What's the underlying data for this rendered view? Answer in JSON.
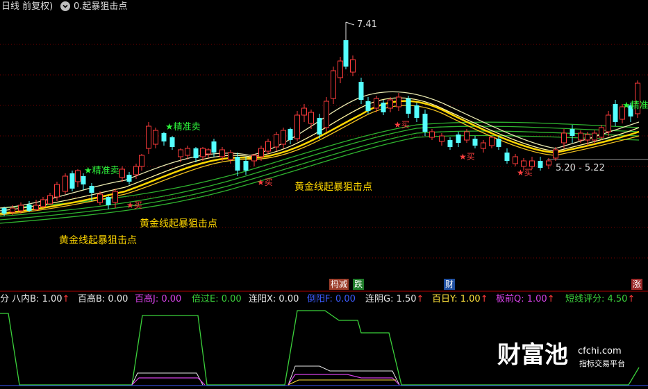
{
  "header": {
    "period": "日线 前复权)",
    "dropdown_icon": "chevron-down-circle-icon",
    "indicator_title": "0.起暴狙击点"
  },
  "colors": {
    "up": "#ff3b3b",
    "down": "#54ffff",
    "gold": "#ffd700",
    "green_ma": "#2fb32f",
    "ma_light": "#fff6a0",
    "buy": "#ff4040",
    "sell": "#2df03a"
  },
  "labels": {
    "price_high": "7.41",
    "price_range": "5.20 - 5.22",
    "sell_signal_1": "★精准卖",
    "sell_signal_2": "★精准卖",
    "sell_signal_3": "★精准",
    "buy_signal": "★买",
    "golden_line_text": "黄金线起暴狙击点"
  },
  "tags": {
    "drop_reduce": "杩减",
    "fall": "跌",
    "finance": "财",
    "rise": "涨"
  },
  "indicators": [
    {
      "label": "分 八内B: 1.00",
      "color": "#e8e8e8",
      "arrow": "↑"
    },
    {
      "label": "百高B: 0.00",
      "color": "#e8e8e8",
      "arrow": ""
    },
    {
      "label": "百高J: 0.00",
      "color": "#d742e8",
      "arrow": ""
    },
    {
      "label": "倍过E: 0.00",
      "color": "#3bd13b",
      "arrow": ""
    },
    {
      "label": "连阳X: 0.00",
      "color": "#e8e8e8",
      "arrow": ""
    },
    {
      "label": "倒阳F: 0.00",
      "color": "#3c5cff",
      "arrow": ""
    },
    {
      "label": "连阴G: 1.50",
      "color": "#e8e8e8",
      "arrow": "↑"
    },
    {
      "label": "百日Y: 1.00",
      "color": "#ffe23b",
      "arrow": "↑"
    },
    {
      "label": "板前Q: 1.00",
      "color": "#d742e8",
      "arrow": "↑"
    },
    {
      "label": "短线评分: 4.50",
      "color": "#3bd13b",
      "arrow": "↑"
    }
  ],
  "watermark": {
    "brand": "财富池",
    "domain": "cfchi.com",
    "slogan": "指标交易平台"
  }
}
